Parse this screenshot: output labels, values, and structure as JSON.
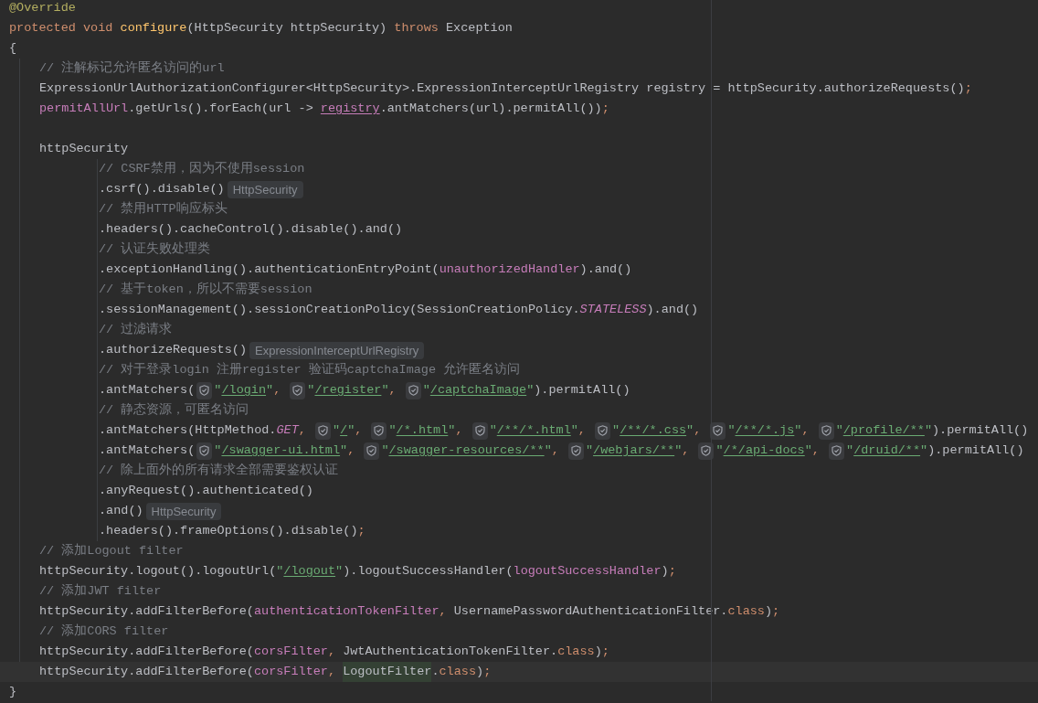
{
  "editor": {
    "lines": [
      {
        "kind": "code",
        "current": false,
        "tokens": [
          {
            "kind": "annotation",
            "text": "@Override"
          }
        ]
      },
      {
        "kind": "code",
        "current": false,
        "tokens": [
          {
            "kind": "keyword",
            "text": "protected void "
          },
          {
            "kind": "declaration",
            "text": "configure"
          },
          {
            "kind": "plain",
            "text": "(HttpSecurity httpSecurity) "
          },
          {
            "kind": "keyword",
            "text": "throws "
          },
          {
            "kind": "plain",
            "text": "Exception"
          }
        ]
      },
      {
        "kind": "code",
        "current": false,
        "tokens": [
          {
            "kind": "plain",
            "text": "{"
          }
        ],
        "children": [
          {
            "kind": "code",
            "current": false,
            "tokens": [
              {
                "kind": "comment",
                "text": "// 注解标记允许匿名访问的url"
              }
            ]
          },
          {
            "kind": "code",
            "current": false,
            "tokens": [
              {
                "kind": "plain",
                "text": "ExpressionUrlAuthorizationConfigurer<HttpSecurity>.ExpressionInterceptUrlRegistry registry = httpSecurity.authorizeRequests()"
              },
              {
                "kind": "punct",
                "text": ";"
              }
            ]
          },
          {
            "kind": "code",
            "current": false,
            "tokens": [
              {
                "kind": "field",
                "text": "permitAllUrl"
              },
              {
                "kind": "plain",
                "text": ".getUrls().forEach(url -> "
              },
              {
                "kind": "reassigned",
                "text": "registry"
              },
              {
                "kind": "plain",
                "text": ".antMatchers(url).permitAll())"
              },
              {
                "kind": "punct",
                "text": ";"
              }
            ]
          },
          {
            "kind": "blank",
            "current": false
          },
          {
            "kind": "code",
            "current": false,
            "tokens": [
              {
                "kind": "plain",
                "text": "httpSecurity"
              }
            ],
            "children": [
              {
                "kind": "code",
                "current": false,
                "tokens": [
                  {
                    "kind": "comment",
                    "text": "// CSRF禁用，因为不使用session"
                  }
                ]
              },
              {
                "kind": "code",
                "current": false,
                "tokens": [
                  {
                    "kind": "plain",
                    "text": ".csrf().disable()"
                  },
                  {
                    "kind": "hint",
                    "text": "HttpSecurity"
                  }
                ]
              },
              {
                "kind": "code",
                "current": false,
                "tokens": [
                  {
                    "kind": "comment",
                    "text": "// 禁用HTTP响应标头"
                  }
                ]
              },
              {
                "kind": "code",
                "current": false,
                "tokens": [
                  {
                    "kind": "plain",
                    "text": ".headers().cacheControl().disable().and()"
                  }
                ]
              },
              {
                "kind": "code",
                "current": false,
                "tokens": [
                  {
                    "kind": "comment",
                    "text": "// 认证失败处理类"
                  }
                ]
              },
              {
                "kind": "code",
                "current": false,
                "tokens": [
                  {
                    "kind": "plain",
                    "text": ".exceptionHandling().authenticationEntryPoint("
                  },
                  {
                    "kind": "field",
                    "text": "unauthorizedHandler"
                  },
                  {
                    "kind": "plain",
                    "text": ").and()"
                  }
                ]
              },
              {
                "kind": "code",
                "current": false,
                "tokens": [
                  {
                    "kind": "comment",
                    "text": "// 基于token，所以不需要session"
                  }
                ]
              },
              {
                "kind": "code",
                "current": false,
                "tokens": [
                  {
                    "kind": "plain",
                    "text": ".sessionManagement().sessionCreationPolicy(SessionCreationPolicy."
                  },
                  {
                    "kind": "static",
                    "text": "STATELESS"
                  },
                  {
                    "kind": "plain",
                    "text": ").and()"
                  }
                ]
              },
              {
                "kind": "code",
                "current": false,
                "tokens": [
                  {
                    "kind": "comment",
                    "text": "// 过滤请求"
                  }
                ]
              },
              {
                "kind": "code",
                "current": false,
                "tokens": [
                  {
                    "kind": "plain",
                    "text": ".authorizeRequests()"
                  },
                  {
                    "kind": "hint",
                    "text": "ExpressionInterceptUrlRegistry"
                  }
                ]
              },
              {
                "kind": "code",
                "current": false,
                "tokens": [
                  {
                    "kind": "comment",
                    "text": "// 对于登录login 注册register 验证码captchaImage 允许匿名访问"
                  }
                ]
              },
              {
                "kind": "code",
                "current": false,
                "tokens": [
                  {
                    "kind": "plain",
                    "text": ".antMatchers("
                  },
                  {
                    "kind": "shield"
                  },
                  {
                    "kind": "string",
                    "text": "\""
                  },
                  {
                    "kind": "url",
                    "text": "/login"
                  },
                  {
                    "kind": "string",
                    "text": "\""
                  },
                  {
                    "kind": "punct",
                    "text": ", "
                  },
                  {
                    "kind": "shield"
                  },
                  {
                    "kind": "string",
                    "text": "\""
                  },
                  {
                    "kind": "url",
                    "text": "/register"
                  },
                  {
                    "kind": "string",
                    "text": "\""
                  },
                  {
                    "kind": "punct",
                    "text": ", "
                  },
                  {
                    "kind": "shield"
                  },
                  {
                    "kind": "string",
                    "text": "\""
                  },
                  {
                    "kind": "url",
                    "text": "/captchaImage"
                  },
                  {
                    "kind": "string",
                    "text": "\""
                  },
                  {
                    "kind": "plain",
                    "text": ").permitAll()"
                  }
                ]
              },
              {
                "kind": "code",
                "current": false,
                "tokens": [
                  {
                    "kind": "comment",
                    "text": "// 静态资源，可匿名访问"
                  }
                ]
              },
              {
                "kind": "code",
                "current": false,
                "tokens": [
                  {
                    "kind": "plain",
                    "text": ".antMatchers(HttpMethod."
                  },
                  {
                    "kind": "static",
                    "text": "GET"
                  },
                  {
                    "kind": "punct",
                    "text": ", "
                  },
                  {
                    "kind": "shield"
                  },
                  {
                    "kind": "string",
                    "text": "\""
                  },
                  {
                    "kind": "url",
                    "text": "/"
                  },
                  {
                    "kind": "string",
                    "text": "\""
                  },
                  {
                    "kind": "punct",
                    "text": ", "
                  },
                  {
                    "kind": "shield"
                  },
                  {
                    "kind": "string",
                    "text": "\""
                  },
                  {
                    "kind": "url",
                    "text": "/*.html"
                  },
                  {
                    "kind": "string",
                    "text": "\""
                  },
                  {
                    "kind": "punct",
                    "text": ", "
                  },
                  {
                    "kind": "shield"
                  },
                  {
                    "kind": "string",
                    "text": "\""
                  },
                  {
                    "kind": "url",
                    "text": "/**/*.html"
                  },
                  {
                    "kind": "string",
                    "text": "\""
                  },
                  {
                    "kind": "punct",
                    "text": ", "
                  },
                  {
                    "kind": "shield"
                  },
                  {
                    "kind": "string",
                    "text": "\""
                  },
                  {
                    "kind": "url",
                    "text": "/**/*.css"
                  },
                  {
                    "kind": "string",
                    "text": "\""
                  },
                  {
                    "kind": "punct",
                    "text": ", "
                  },
                  {
                    "kind": "shield"
                  },
                  {
                    "kind": "string",
                    "text": "\""
                  },
                  {
                    "kind": "url",
                    "text": "/**/*.js"
                  },
                  {
                    "kind": "string",
                    "text": "\""
                  },
                  {
                    "kind": "punct",
                    "text": ", "
                  },
                  {
                    "kind": "shield"
                  },
                  {
                    "kind": "string",
                    "text": "\""
                  },
                  {
                    "kind": "url",
                    "text": "/profile/**"
                  },
                  {
                    "kind": "string",
                    "text": "\""
                  },
                  {
                    "kind": "plain",
                    "text": ").permitAll()"
                  }
                ]
              },
              {
                "kind": "code",
                "current": false,
                "tokens": [
                  {
                    "kind": "plain",
                    "text": ".antMatchers("
                  },
                  {
                    "kind": "shield"
                  },
                  {
                    "kind": "string",
                    "text": "\""
                  },
                  {
                    "kind": "url",
                    "text": "/swagger-ui.html"
                  },
                  {
                    "kind": "string",
                    "text": "\""
                  },
                  {
                    "kind": "punct",
                    "text": ", "
                  },
                  {
                    "kind": "shield"
                  },
                  {
                    "kind": "string",
                    "text": "\""
                  },
                  {
                    "kind": "url",
                    "text": "/swagger-resources/**"
                  },
                  {
                    "kind": "string",
                    "text": "\""
                  },
                  {
                    "kind": "punct",
                    "text": ", "
                  },
                  {
                    "kind": "shield"
                  },
                  {
                    "kind": "string",
                    "text": "\""
                  },
                  {
                    "kind": "url",
                    "text": "/webjars/**"
                  },
                  {
                    "kind": "string",
                    "text": "\""
                  },
                  {
                    "kind": "punct",
                    "text": ", "
                  },
                  {
                    "kind": "shield"
                  },
                  {
                    "kind": "string",
                    "text": "\""
                  },
                  {
                    "kind": "url",
                    "text": "/*/api-docs"
                  },
                  {
                    "kind": "string",
                    "text": "\""
                  },
                  {
                    "kind": "punct",
                    "text": ", "
                  },
                  {
                    "kind": "shield"
                  },
                  {
                    "kind": "string",
                    "text": "\""
                  },
                  {
                    "kind": "url",
                    "text": "/druid/**"
                  },
                  {
                    "kind": "string",
                    "text": "\""
                  },
                  {
                    "kind": "plain",
                    "text": ").permitAll()"
                  }
                ]
              },
              {
                "kind": "code",
                "current": false,
                "tokens": [
                  {
                    "kind": "comment",
                    "text": "// 除上面外的所有请求全部需要鉴权认证"
                  }
                ]
              },
              {
                "kind": "code",
                "current": false,
                "tokens": [
                  {
                    "kind": "plain",
                    "text": ".anyRequest().authenticated()"
                  }
                ]
              },
              {
                "kind": "code",
                "current": false,
                "tokens": [
                  {
                    "kind": "plain",
                    "text": ".and()"
                  },
                  {
                    "kind": "hint",
                    "text": "HttpSecurity"
                  }
                ]
              },
              {
                "kind": "code",
                "current": false,
                "tokens": [
                  {
                    "kind": "plain",
                    "text": ".headers().frameOptions().disable()"
                  },
                  {
                    "kind": "punct",
                    "text": ";"
                  }
                ]
              }
            ]
          },
          {
            "kind": "code",
            "current": false,
            "tokens": [
              {
                "kind": "comment",
                "text": "// 添加Logout filter"
              }
            ]
          },
          {
            "kind": "code",
            "current": false,
            "tokens": [
              {
                "kind": "plain",
                "text": "httpSecurity.logout().logoutUrl("
              },
              {
                "kind": "string",
                "text": "\""
              },
              {
                "kind": "url",
                "text": "/logout"
              },
              {
                "kind": "string",
                "text": "\""
              },
              {
                "kind": "plain",
                "text": ").logoutSuccessHandler("
              },
              {
                "kind": "field",
                "text": "logoutSuccessHandler"
              },
              {
                "kind": "plain",
                "text": ")"
              },
              {
                "kind": "punct",
                "text": ";"
              }
            ]
          },
          {
            "kind": "code",
            "current": false,
            "tokens": [
              {
                "kind": "comment",
                "text": "// 添加JWT filter"
              }
            ]
          },
          {
            "kind": "code",
            "current": false,
            "tokens": [
              {
                "kind": "plain",
                "text": "httpSecurity.addFilterBefore("
              },
              {
                "kind": "field",
                "text": "authenticationTokenFilter"
              },
              {
                "kind": "punct",
                "text": ", "
              },
              {
                "kind": "plain",
                "text": "UsernamePasswordAuthenticationFilter."
              },
              {
                "kind": "keyword",
                "text": "class"
              },
              {
                "kind": "plain",
                "text": ")"
              },
              {
                "kind": "punct",
                "text": ";"
              }
            ]
          },
          {
            "kind": "code",
            "current": false,
            "tokens": [
              {
                "kind": "comment",
                "text": "// 添加CORS filter"
              }
            ]
          },
          {
            "kind": "code",
            "current": false,
            "tokens": [
              {
                "kind": "plain",
                "text": "httpSecurity.addFilterBefore("
              },
              {
                "kind": "field",
                "text": "corsFilter"
              },
              {
                "kind": "punct",
                "text": ", "
              },
              {
                "kind": "plain",
                "text": "JwtAuthenticationTokenFilter."
              },
              {
                "kind": "keyword",
                "text": "class"
              },
              {
                "kind": "plain",
                "text": ")"
              },
              {
                "kind": "punct",
                "text": ";"
              }
            ]
          },
          {
            "kind": "code",
            "current": true,
            "tokens": [
              {
                "kind": "plain",
                "text": "httpSecurity.addFilterBefore("
              },
              {
                "kind": "field",
                "text": "corsFilter"
              },
              {
                "kind": "punct",
                "text": ", "
              },
              {
                "kind": "match",
                "text": "LogoutFilter"
              },
              {
                "kind": "plain",
                "text": "."
              },
              {
                "kind": "keyword",
                "text": "class"
              },
              {
                "kind": "plain",
                "text": ")"
              },
              {
                "kind": "punct",
                "text": ";"
              }
            ]
          }
        ]
      },
      {
        "kind": "code",
        "current": false,
        "tokens": [
          {
            "kind": "plain",
            "text": "}"
          }
        ]
      }
    ]
  }
}
